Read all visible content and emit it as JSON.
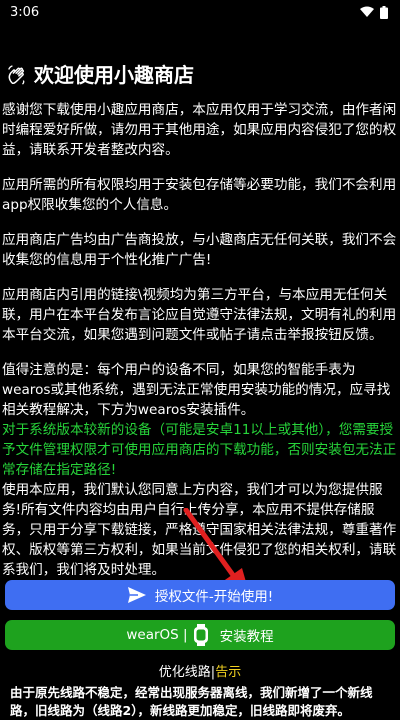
{
  "status_bar": {
    "time": "3:06"
  },
  "header": {
    "title": "欢迎使用小趣商店"
  },
  "content": {
    "p1": "感谢您下载使用小趣应用商店，本应用仅用于学习交流，由作者闲时编程爱好所做，请勿用于其他用途，如果应用内容侵犯了您的权益，请联系开发者整改内容。",
    "p2": "应用所需的所有权限均用于安装包存储等必要功能，我们不会利用app权限收集您的个人信息。",
    "p3": "应用商店广告均由广告商投放，与小趣商店无任何关联，我们不会收集您的信息用于个性化推广广告!",
    "p4": "应用商店内引用的链接\\视频均为第三方平台，与本应用无任何关联，用户在本平台发布言论应自觉遵守法律法规，文明有礼的利用本平台交流，如果您遇到问题文件或帖子请点击举报按钮反馈。",
    "p5": "值得注意的是：每个用户的设备不同，如果您的智能手表为wearos或其他系统，遇到无法正常使用安装功能的情况，应寻找相关教程解决，下方为wearos安装插件。",
    "green_text": "对于系统版本较新的设备（可能是安卓11以上或其他），您需要授予文件管理权限才可使用应用商店的下载功能，否则安装包无法正常存储在指定路径!",
    "agree_text": "使用本应用，我们默认您同意上方内容，我们才可以为您提供服务!所有文件内容均由用户自行上传分享，本应用不提供存储服务，只用于分享下载链接，严格遵守国家相关法律法规，尊重著作权、版权等第三方权利，如果当前文件侵犯了您的相关权利，请联系我们，我们将及时处理。"
  },
  "buttons": {
    "authorize_label": "授权文件-开始使用!",
    "wearos_prefix": "wearOS |",
    "wearos_label": "安装教程"
  },
  "footer": {
    "optimize_label": "优化线路",
    "separator": "|",
    "notice_label": "告示",
    "notice_text": "由于原先线路不稳定，经常出现服务器离线，我们新增了一个新线路，旧线路为（线路2），新线路更加稳定，旧线路即将废弃。"
  },
  "colors": {
    "primary_button": "#3f6ef2",
    "green_button": "#1ea21e",
    "green_text": "#27d43a",
    "notice": "#f0d020"
  }
}
